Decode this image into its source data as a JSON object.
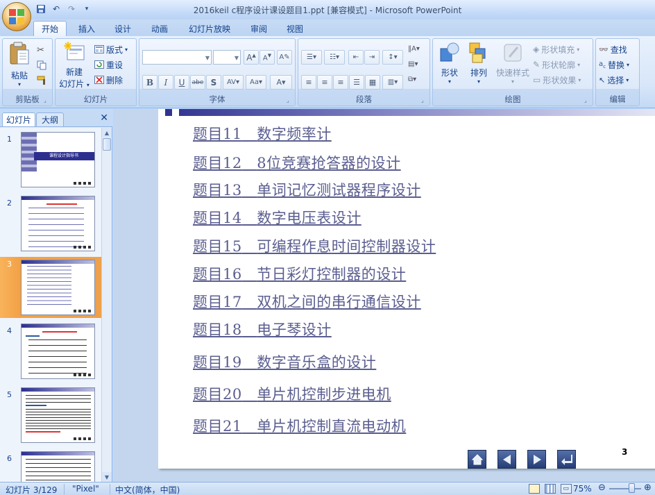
{
  "window": {
    "title": "2016keil c程序设计课设题目1.ppt [兼容模式] - Microsoft PowerPoint"
  },
  "tabs": [
    "开始",
    "插入",
    "设计",
    "动画",
    "幻灯片放映",
    "审阅",
    "视图"
  ],
  "ribbon": {
    "clipboard": {
      "label": "剪贴板",
      "paste": "粘贴"
    },
    "slides": {
      "label": "幻灯片",
      "new_slide": "新建\n幻灯片",
      "new_slide_line1": "新建",
      "new_slide_line2": "幻灯片",
      "layout": "版式",
      "reset": "重设",
      "delete": "删除"
    },
    "font": {
      "label": "字体"
    },
    "paragraph": {
      "label": "段落"
    },
    "drawing": {
      "label": "绘图",
      "shapes": "形状",
      "arrange": "排列",
      "quick_styles": "快速样式",
      "shape_fill": "形状填充",
      "shape_outline": "形状轮廓",
      "shape_effects": "形状效果"
    },
    "editing": {
      "label": "编辑",
      "find": "查找",
      "replace": "替换",
      "select": "选择"
    }
  },
  "left_panel": {
    "tabs": [
      "幻灯片",
      "大纲"
    ],
    "close": "✕",
    "thumbnails": [
      {
        "num": "1",
        "caption": "课程设计指导书"
      },
      {
        "num": "2"
      },
      {
        "num": "3",
        "selected": true
      },
      {
        "num": "4"
      },
      {
        "num": "5"
      },
      {
        "num": "6"
      }
    ]
  },
  "slide": {
    "topics": [
      {
        "num": "题目11",
        "text": "数字频率计"
      },
      {
        "num": "题目12",
        "text": "8位竞赛抢答器的设计"
      },
      {
        "num": "题目13",
        "text": "单词记忆测试器程序设计"
      },
      {
        "num": "题目14",
        "text": "数字电压表设计"
      },
      {
        "num": "题目15",
        "text": "可编程作息时间控制器设计"
      },
      {
        "num": "题目16",
        "text": "节日彩灯控制器的设计"
      },
      {
        "num": "题目17",
        "text": "双机之间的串行通信设计"
      },
      {
        "num": "题目18",
        "text": "电子琴设计"
      },
      {
        "num": "题目19",
        "text": "数字音乐盒的设计"
      },
      {
        "num": "题目20",
        "text": "单片机控制步进电机"
      },
      {
        "num": "题目21",
        "text": "单片机控制直流电动机"
      }
    ],
    "page_number": "3"
  },
  "status": {
    "slide_info": "幻灯片 3/129",
    "theme": "\"Pixel\"",
    "language": "中文(简体，中国)",
    "zoom": "75%"
  },
  "colors": {
    "topic_text": "#5a5d8f",
    "selected_thumb": "#f3a146",
    "ribbon_bg": "#d7e6f9",
    "slide_bg": "#ffffff"
  }
}
